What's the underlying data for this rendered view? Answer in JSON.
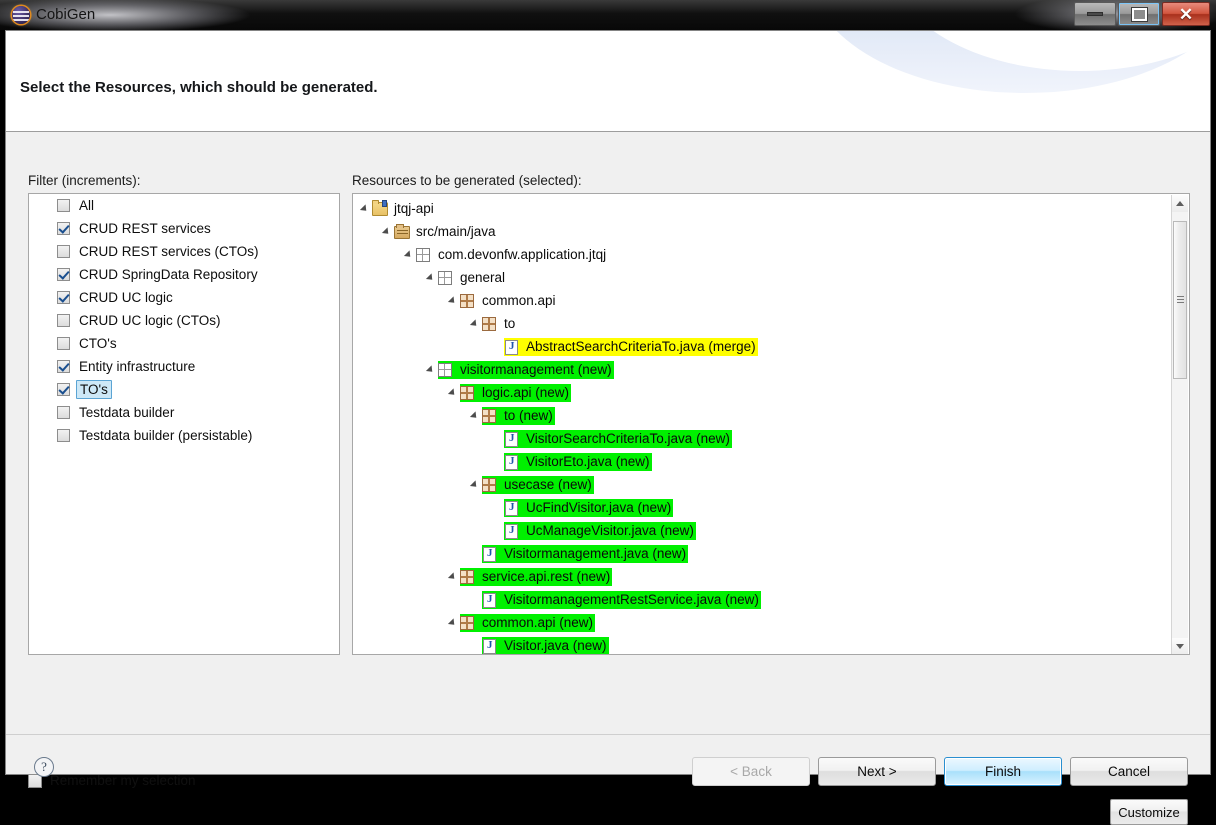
{
  "window": {
    "title": "CobiGen",
    "app_icon": "cobigen-logo-icon",
    "buttons": {
      "minimize": "minimize-icon",
      "maximize": "maximize-icon",
      "close": "close-icon",
      "close_glyph": "✕"
    }
  },
  "header": {
    "title": "Select the Resources, which should be generated."
  },
  "filter": {
    "label": "Filter (increments):",
    "items": [
      {
        "label": "All",
        "checked": false,
        "selected": false
      },
      {
        "label": "CRUD REST services",
        "checked": true,
        "selected": false
      },
      {
        "label": "CRUD REST services (CTOs)",
        "checked": false,
        "selected": false
      },
      {
        "label": "CRUD SpringData Repository",
        "checked": true,
        "selected": false
      },
      {
        "label": "CRUD UC logic",
        "checked": true,
        "selected": false
      },
      {
        "label": "CRUD UC logic (CTOs)",
        "checked": false,
        "selected": false
      },
      {
        "label": "CTO's",
        "checked": false,
        "selected": false
      },
      {
        "label": "Entity infrastructure",
        "checked": true,
        "selected": false
      },
      {
        "label": "TO's",
        "checked": true,
        "selected": true
      },
      {
        "label": "Testdata builder",
        "checked": false,
        "selected": false
      },
      {
        "label": "Testdata builder (persistable)",
        "checked": false,
        "selected": false
      }
    ]
  },
  "resources": {
    "label": "Resources to be generated (selected):",
    "tree": [
      {
        "label": "jtqj-api",
        "depth": 0,
        "icon": "project-folder-icon",
        "arrow": true,
        "highlight": "none"
      },
      {
        "label": "src/main/java",
        "depth": 1,
        "icon": "source-folder-icon",
        "arrow": true,
        "highlight": "none"
      },
      {
        "label": "com.devonfw.application.jtqj",
        "depth": 2,
        "icon": "package-empty-icon",
        "arrow": true,
        "highlight": "none"
      },
      {
        "label": "general",
        "depth": 3,
        "icon": "package-empty-icon",
        "arrow": true,
        "highlight": "none"
      },
      {
        "label": "common.api",
        "depth": 4,
        "icon": "package-filled-icon",
        "arrow": true,
        "highlight": "none"
      },
      {
        "label": "to",
        "depth": 5,
        "icon": "package-filled-icon",
        "arrow": true,
        "highlight": "none"
      },
      {
        "label": "AbstractSearchCriteriaTo.java (merge)",
        "depth": 6,
        "icon": "java-file-icon",
        "arrow": false,
        "highlight": "yellow"
      },
      {
        "label": "visitormanagement (new)",
        "depth": 3,
        "icon": "package-empty-icon",
        "arrow": true,
        "highlight": "green"
      },
      {
        "label": "logic.api (new)",
        "depth": 4,
        "icon": "package-filled-icon",
        "arrow": true,
        "highlight": "green"
      },
      {
        "label": "to (new)",
        "depth": 5,
        "icon": "package-filled-icon",
        "arrow": true,
        "highlight": "green"
      },
      {
        "label": "VisitorSearchCriteriaTo.java (new)",
        "depth": 6,
        "icon": "java-file-icon",
        "arrow": false,
        "highlight": "green"
      },
      {
        "label": "VisitorEto.java (new)",
        "depth": 6,
        "icon": "java-file-icon",
        "arrow": false,
        "highlight": "green"
      },
      {
        "label": "usecase (new)",
        "depth": 5,
        "icon": "package-filled-icon",
        "arrow": true,
        "highlight": "green"
      },
      {
        "label": "UcFindVisitor.java (new)",
        "depth": 6,
        "icon": "java-file-icon",
        "arrow": false,
        "highlight": "green"
      },
      {
        "label": "UcManageVisitor.java (new)",
        "depth": 6,
        "icon": "java-file-icon",
        "arrow": false,
        "highlight": "green"
      },
      {
        "label": "Visitormanagement.java (new)",
        "depth": 5,
        "icon": "java-file-icon",
        "arrow": false,
        "highlight": "green"
      },
      {
        "label": "service.api.rest (new)",
        "depth": 4,
        "icon": "package-filled-icon",
        "arrow": true,
        "highlight": "green"
      },
      {
        "label": "VisitormanagementRestService.java (new)",
        "depth": 5,
        "icon": "java-file-icon",
        "arrow": false,
        "highlight": "green"
      },
      {
        "label": "common.api (new)",
        "depth": 4,
        "icon": "package-filled-icon",
        "arrow": true,
        "highlight": "green"
      },
      {
        "label": "Visitor.java (new)",
        "depth": 5,
        "icon": "java-file-icon",
        "arrow": false,
        "highlight": "green"
      }
    ],
    "scrollbar": {
      "up_arrow": "scroll-up-icon",
      "down_arrow": "scroll-down-icon"
    }
  },
  "options": {
    "remember_label": "Remember my selection",
    "remember_checked": false,
    "customize_label": "Customize"
  },
  "footer": {
    "help": "?",
    "back": "< Back",
    "next": "Next >",
    "finish": "Finish",
    "cancel": "Cancel"
  },
  "colors": {
    "highlight_new": "#00f000",
    "highlight_merge": "#ffff00",
    "selection": "#cde8f7",
    "primary_button": "#a9e0fb"
  }
}
